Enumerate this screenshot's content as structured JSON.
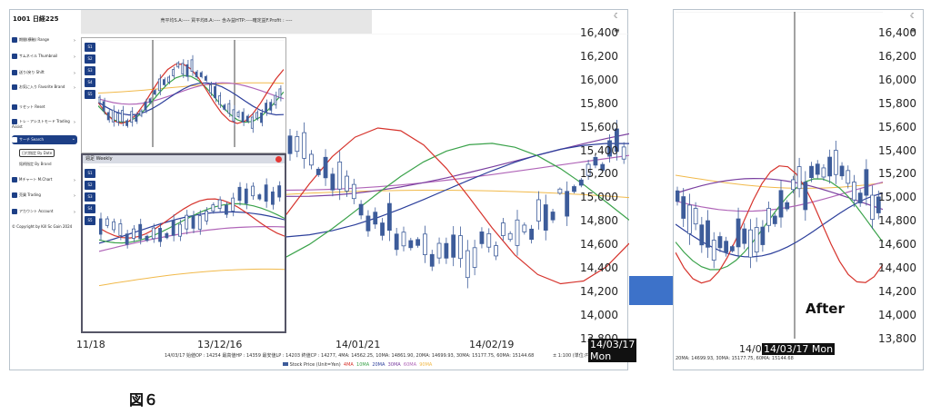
{
  "app": {
    "title": "1001 日経225"
  },
  "sidebar": {
    "items": [
      {
        "label": "期間(横軸) Range"
      },
      {
        "label": "サムネイル Thumbnail"
      },
      {
        "label": "送り/戻り Shift"
      },
      {
        "label": "お気に入り Favorite  Brand"
      },
      {
        "label": "リセット Reset"
      },
      {
        "label": "トレ・アシストモード Trading Assist"
      },
      {
        "label": "サーチ Search"
      },
      {
        "label": "Mチャート M.Chart"
      },
      {
        "label": "売買 Trading"
      },
      {
        "label": "アカウント Account"
      }
    ],
    "sub_items": [
      "日付指定 By Date",
      "銘柄指定 By Brand"
    ],
    "copyright": "© Copyright by",
    "copyright_year": "2024",
    "copyright_org": "Kill Sc Gain"
  },
  "topbar": {
    "text": "売平均S.A:---- 買平均B.A:---- 含み益HTP:----確定益F.Profit : ----"
  },
  "inset_weekly": {
    "title": "週足 Weekly"
  },
  "inset_tabs": [
    "S1",
    "S2",
    "S3",
    "S4",
    "S5"
  ],
  "main_chart": {
    "x_ticks": [
      "11/18",
      "13/12/16",
      "14/01/21",
      "14/02/19"
    ],
    "y_ticks": [
      "16,400",
      "16,200",
      "16,000",
      "15,800",
      "15,600",
      "15,400",
      "15,200",
      "15,000",
      "14,800",
      "14,600",
      "14,400",
      "14,200",
      "14,000",
      "13,800"
    ],
    "date_badge": "14/03/17 Mon",
    "info_line": "14/03/17 始値OP : 14254  最高値HP : 14359 最安値LP : 14203  終値CP : 14277, 4MA: 14562.25, 10MA: 14861.90, 20MA: 14699.93, 30MA: 15177.75, 60MA: 15144.68",
    "legend": [
      "Stock Price (Unit=Yen)",
      "4MA",
      "10MA",
      "20MA",
      "30MA",
      "60MA",
      "90MA"
    ],
    "corner_text": "± 1:100 (単位:円)"
  },
  "after_chart": {
    "label": "After",
    "x_tick": "14/03",
    "date_badge": "14/03/17 Mon",
    "info_line": "20MA: 14699.93, 30MA: 15177.75, 60MA: 15144.68",
    "y_ticks": [
      "16,400",
      "16,200",
      "16,000",
      "15,800",
      "15,600",
      "15,400",
      "15,200",
      "15,000",
      "14,800",
      "14,600",
      "14,400",
      "14,200",
      "14,000",
      "13,800"
    ]
  },
  "figure_caption": "図６",
  "colors": {
    "candle": "#3d5c9a",
    "ma4": "#d6332c",
    "ma10": "#3aa24a",
    "ma20": "#2c3f9b",
    "ma30": "#7a3fa0",
    "ma60": "#b065b8",
    "ma90": "#f1b94a",
    "arrow": "#3d72c9",
    "sidebar": "#1d3f86"
  }
}
